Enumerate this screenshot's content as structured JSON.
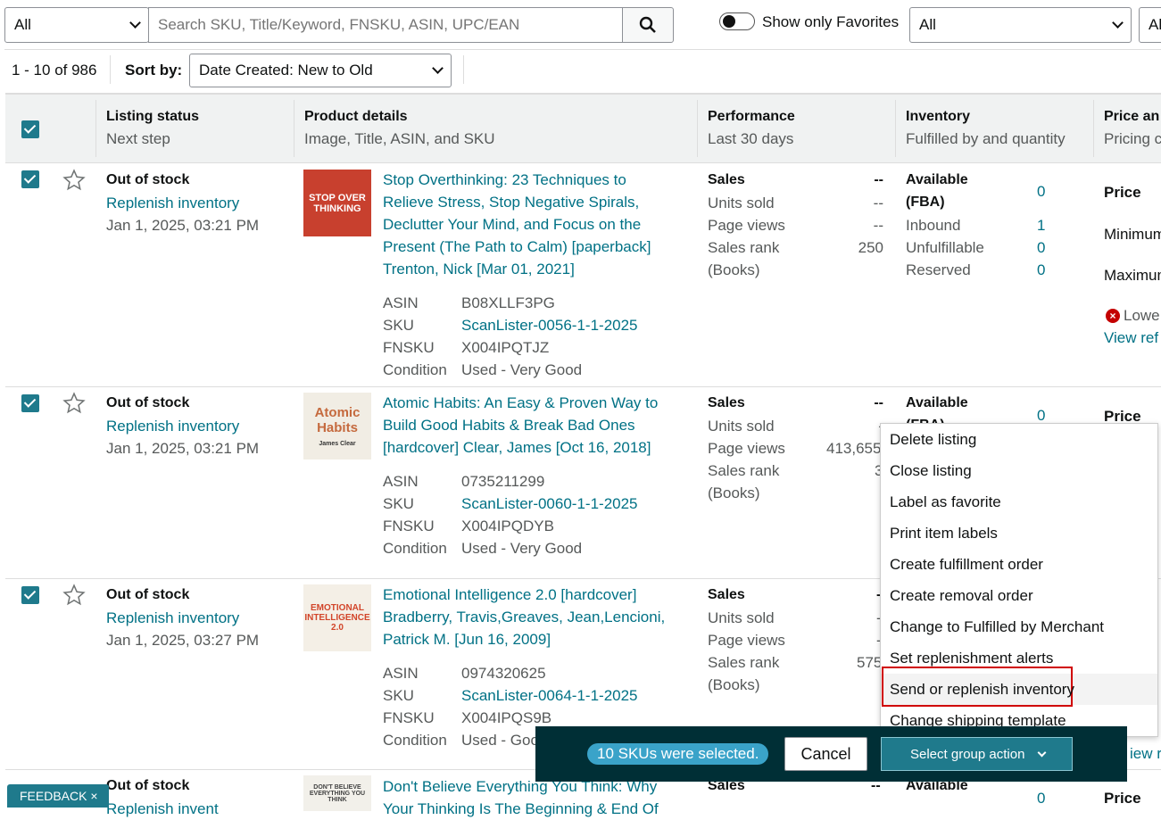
{
  "search": {
    "scope": "All",
    "placeholder": "Search SKU, Title/Keyword, FNSKU, ASIN, UPC/EAN",
    "fav_label": "Show only Favorites",
    "filter1": "All",
    "filter2": "Al"
  },
  "toolbar": {
    "count": "1 - 10 of 986",
    "sort_label": "Sort by:",
    "sort_value": "Date Created: New to Old"
  },
  "headers": {
    "status": "Listing status",
    "status_sub": "Next step",
    "product": "Product details",
    "product_sub": "Image, Title, ASIN, and SKU",
    "perf": "Performance",
    "perf_sub": "Last 30 days",
    "inv": "Inventory",
    "inv_sub": "Fulfilled by and quantity",
    "price": "Price an",
    "price_sub": "Pricing c"
  },
  "labels": {
    "asin": "ASIN",
    "sku": "SKU",
    "fnsku": "FNSKU",
    "condition": "Condition",
    "sales": "Sales",
    "units_sold": "Units sold",
    "page_views": "Page views",
    "sales_rank": "Sales rank",
    "books": "(Books)",
    "available": "Available",
    "fba": "(FBA)",
    "inbound": "Inbound",
    "unfulfillable": "Unfulfillable",
    "reserved": "Reserved",
    "price": "Price",
    "minimum": "Minimum",
    "maximum": "Maximum",
    "lowest": "Lowe",
    "view_ref": "View ref",
    "view_ref2": "iew ref"
  },
  "rows": [
    {
      "status": "Out of stock",
      "next": "Replenish inventory",
      "date": "Jan 1, 2025, 03:21 PM",
      "title": "Stop Overthinking: 23 Techniques to Relieve Stress, Stop Negative Spirals, Declutter Your Mind, and Focus on the Present (The Path to Calm) [paperback] Trenton, Nick [Mar 01, 2021]",
      "asin": "B08XLLF3PG",
      "sku": "ScanLister-0056-1-1-2025",
      "fnsku": "X004IPQTJZ",
      "condition": "Used - Very Good",
      "sales": "--",
      "units": "--",
      "views": "--",
      "rank": "250",
      "avail": "0",
      "inbound": "1",
      "unful": "0",
      "reserved": "0",
      "thumb": "STOP OVER THINKING"
    },
    {
      "status": "Out of stock",
      "next": "Replenish inventory",
      "date": "Jan 1, 2025, 03:21 PM",
      "title": "Atomic Habits: An Easy & Proven Way to Build Good Habits & Break Bad Ones [hardcover] Clear, James [Oct 16, 2018]",
      "asin": "0735211299",
      "sku": "ScanLister-0060-1-1-2025",
      "fnsku": "X004IPQDYB",
      "condition": "Used - Very Good",
      "sales": "--",
      "units": "-",
      "views": "413,655",
      "rank": "3",
      "avail": "0",
      "thumb": "Atomic Habits",
      "author": "James Clear"
    },
    {
      "status": "Out of stock",
      "next": "Replenish inventory",
      "date": "Jan 1, 2025, 03:27 PM",
      "title": "Emotional Intelligence 2.0 [hardcover] Bradberry, Travis,Greaves, Jean,Lencioni, Patrick M. [Jun 16, 2009]",
      "asin": "0974320625",
      "sku": "ScanLister-0064-1-1-2025",
      "fnsku": "X004IPQS9B",
      "condition": "Used - Goo",
      "sales": "-",
      "units": "-",
      "views": "-",
      "rank": "575",
      "thumb": "EMOTIONAL INTELLIGENCE 2.0"
    },
    {
      "status": "Out of stock",
      "next": "Replenish invent",
      "title": "Don't Believe Everything You Think: Why Your Thinking Is The Beginning & End Of",
      "sales": "--",
      "avail": "0",
      "thumb": "DON'T BELIEVE EVERYTHING YOU THINK"
    }
  ],
  "menu": {
    "items": [
      "Delete listing",
      "Close listing",
      "Label as favorite",
      "Print item labels",
      "Create fulfillment order",
      "Create removal order",
      "Change to Fulfilled by Merchant",
      "Set replenishment alerts",
      "Send or replenish inventory",
      "Change shipping template"
    ]
  },
  "bar": {
    "selected": "10 SKUs were selected.",
    "cancel": "Cancel",
    "group": "Select group action"
  },
  "feedback": "FEEDBACK",
  "colors": {
    "teal": "#007185",
    "bar": "#002f36",
    "accent": "#1f7a8c",
    "highlight": "#d00000"
  }
}
